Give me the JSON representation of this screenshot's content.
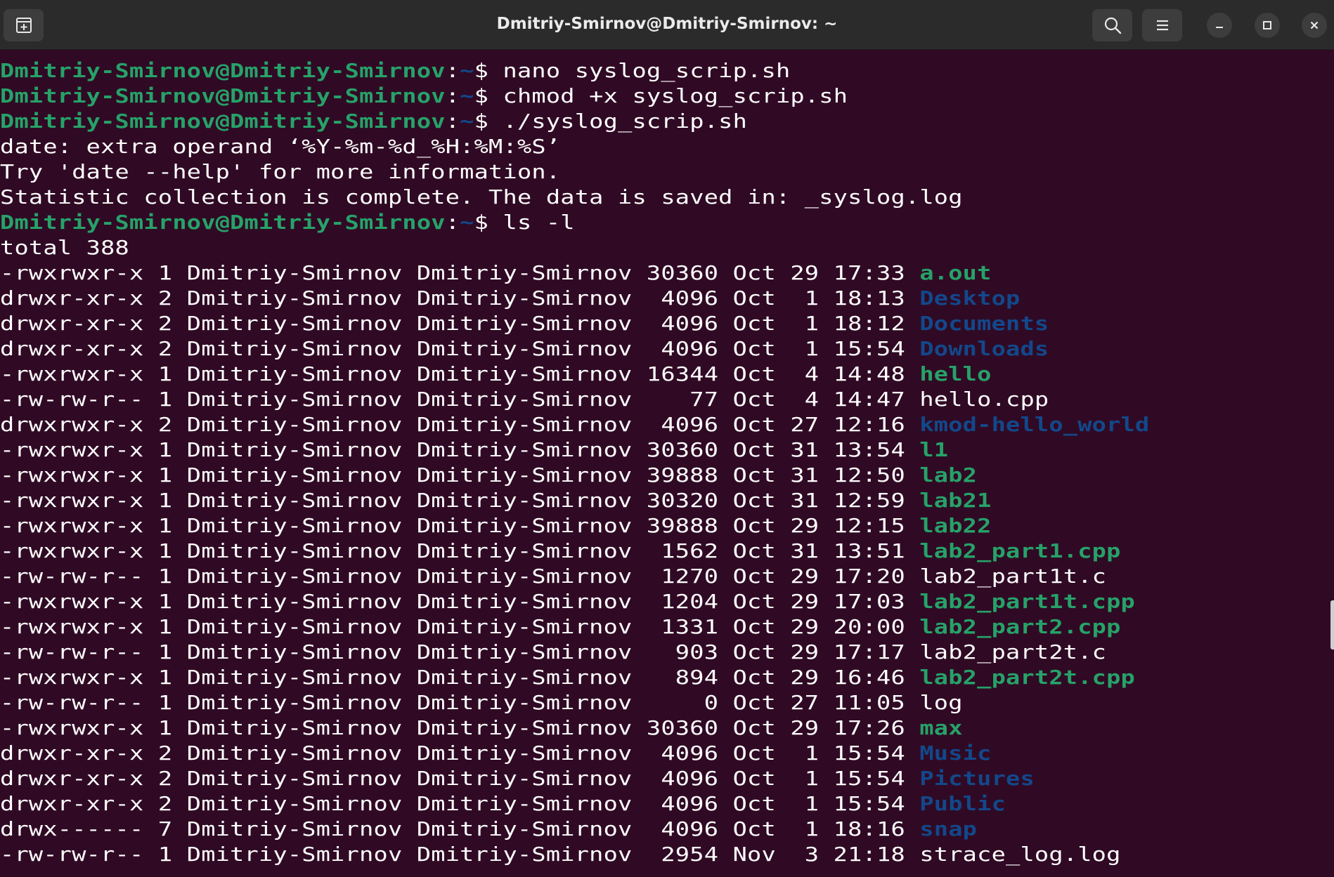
{
  "window": {
    "title": "Dmitriy-Smirnov@Dmitriy-Smirnov: ~",
    "icons": {
      "new_tab": "new-tab-icon",
      "search": "search-icon",
      "menu": "hamburger-menu-icon",
      "minimize": "minimize-icon",
      "maximize": "maximize-icon",
      "close": "close-icon"
    }
  },
  "prompt": {
    "user_host": "Dmitriy-Smirnov@Dmitriy-Smirnov",
    "sep": ":",
    "path": "~",
    "symbol": "$ "
  },
  "colors": {
    "background": "#300a24",
    "prompt_user": "#26a269",
    "prompt_path": "#12488b",
    "executable": "#26a269",
    "directory": "#12488b",
    "text": "#ffffff"
  },
  "commands": [
    "nano syslog_scrip.sh",
    "chmod +x syslog_scrip.sh",
    "./syslog_scrip.sh"
  ],
  "outputs": [
    "date: extra operand ‘%Y-%m-%d_%H:%M:%S’",
    "Try 'date --help' for more information.",
    "Statistic collection is complete. The data is saved in: _syslog.log"
  ],
  "ls_command": "ls -l",
  "total": "total 388",
  "listing": [
    {
      "prefix": "-rwxrwxr-x 1 Dmitriy-Smirnov Dmitriy-Smirnov 30360 Oct 29 17:33 ",
      "name": "a.out",
      "kind": "exe"
    },
    {
      "prefix": "drwxr-xr-x 2 Dmitriy-Smirnov Dmitriy-Smirnov  4096 Oct  1 18:13 ",
      "name": "Desktop",
      "kind": "dir"
    },
    {
      "prefix": "drwxr-xr-x 2 Dmitriy-Smirnov Dmitriy-Smirnov  4096 Oct  1 18:12 ",
      "name": "Documents",
      "kind": "dir"
    },
    {
      "prefix": "drwxr-xr-x 2 Dmitriy-Smirnov Dmitriy-Smirnov  4096 Oct  1 15:54 ",
      "name": "Downloads",
      "kind": "dir"
    },
    {
      "prefix": "-rwxrwxr-x 1 Dmitriy-Smirnov Dmitriy-Smirnov 16344 Oct  4 14:48 ",
      "name": "hello",
      "kind": "exe"
    },
    {
      "prefix": "-rw-rw-r-- 1 Dmitriy-Smirnov Dmitriy-Smirnov    77 Oct  4 14:47 ",
      "name": "hello.cpp",
      "kind": "file"
    },
    {
      "prefix": "drwxrwxr-x 2 Dmitriy-Smirnov Dmitriy-Smirnov  4096 Oct 27 12:16 ",
      "name": "kmod-hello_world",
      "kind": "dir"
    },
    {
      "prefix": "-rwxrwxr-x 1 Dmitriy-Smirnov Dmitriy-Smirnov 30360 Oct 31 13:54 ",
      "name": "l1",
      "kind": "exe"
    },
    {
      "prefix": "-rwxrwxr-x 1 Dmitriy-Smirnov Dmitriy-Smirnov 39888 Oct 31 12:50 ",
      "name": "lab2",
      "kind": "exe"
    },
    {
      "prefix": "-rwxrwxr-x 1 Dmitriy-Smirnov Dmitriy-Smirnov 30320 Oct 31 12:59 ",
      "name": "lab21",
      "kind": "exe"
    },
    {
      "prefix": "-rwxrwxr-x 1 Dmitriy-Smirnov Dmitriy-Smirnov 39888 Oct 29 12:15 ",
      "name": "lab22",
      "kind": "exe"
    },
    {
      "prefix": "-rwxrwxr-x 1 Dmitriy-Smirnov Dmitriy-Smirnov  1562 Oct 31 13:51 ",
      "name": "lab2_part1.cpp",
      "kind": "exe"
    },
    {
      "prefix": "-rw-rw-r-- 1 Dmitriy-Smirnov Dmitriy-Smirnov  1270 Oct 29 17:20 ",
      "name": "lab2_part1t.c",
      "kind": "file"
    },
    {
      "prefix": "-rwxrwxr-x 1 Dmitriy-Smirnov Dmitriy-Smirnov  1204 Oct 29 17:03 ",
      "name": "lab2_part1t.cpp",
      "kind": "exe"
    },
    {
      "prefix": "-rwxrwxr-x 1 Dmitriy-Smirnov Dmitriy-Smirnov  1331 Oct 29 20:00 ",
      "name": "lab2_part2.cpp",
      "kind": "exe"
    },
    {
      "prefix": "-rw-rw-r-- 1 Dmitriy-Smirnov Dmitriy-Smirnov   903 Oct 29 17:17 ",
      "name": "lab2_part2t.c",
      "kind": "file"
    },
    {
      "prefix": "-rwxrwxr-x 1 Dmitriy-Smirnov Dmitriy-Smirnov   894 Oct 29 16:46 ",
      "name": "lab2_part2t.cpp",
      "kind": "exe"
    },
    {
      "prefix": "-rw-rw-r-- 1 Dmitriy-Smirnov Dmitriy-Smirnov     0 Oct 27 11:05 ",
      "name": "log",
      "kind": "file"
    },
    {
      "prefix": "-rwxrwxr-x 1 Dmitriy-Smirnov Dmitriy-Smirnov 30360 Oct 29 17:26 ",
      "name": "max",
      "kind": "exe"
    },
    {
      "prefix": "drwxr-xr-x 2 Dmitriy-Smirnov Dmitriy-Smirnov  4096 Oct  1 15:54 ",
      "name": "Music",
      "kind": "dir"
    },
    {
      "prefix": "drwxr-xr-x 2 Dmitriy-Smirnov Dmitriy-Smirnov  4096 Oct  1 15:54 ",
      "name": "Pictures",
      "kind": "dir"
    },
    {
      "prefix": "drwxr-xr-x 2 Dmitriy-Smirnov Dmitriy-Smirnov  4096 Oct  1 15:54 ",
      "name": "Public",
      "kind": "dir"
    },
    {
      "prefix": "drwx------ 7 Dmitriy-Smirnov Dmitriy-Smirnov  4096 Oct  1 18:16 ",
      "name": "snap",
      "kind": "dir"
    },
    {
      "prefix": "-rw-rw-r-- 1 Dmitriy-Smirnov Dmitriy-Smirnov  2954 Nov  3 21:18 ",
      "name": "strace_log.log",
      "kind": "file"
    }
  ]
}
